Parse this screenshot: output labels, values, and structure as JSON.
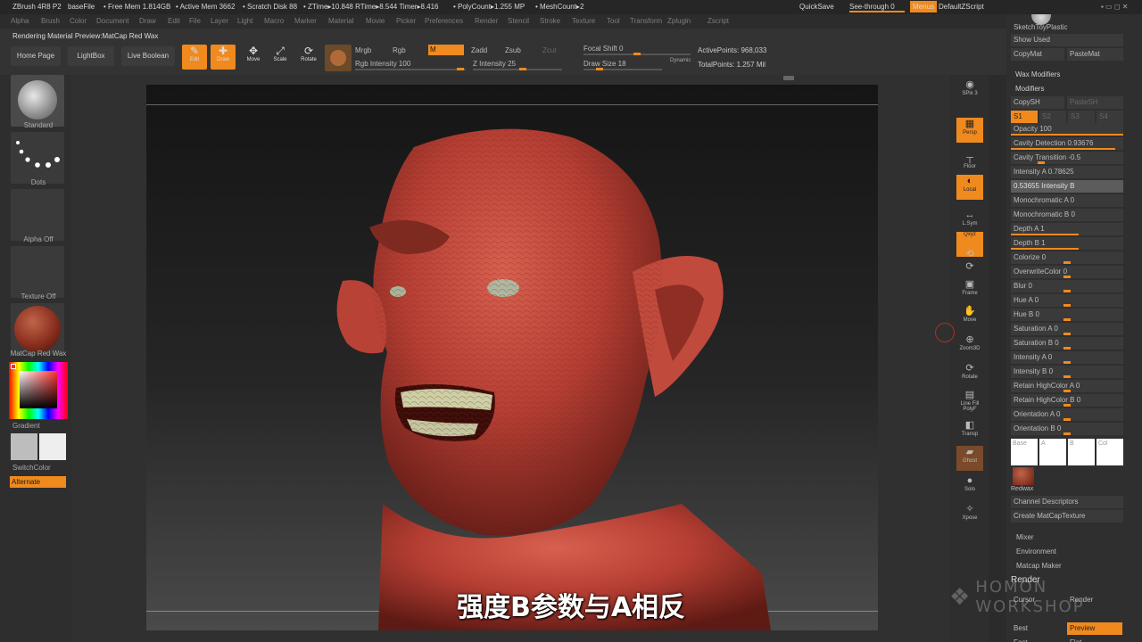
{
  "titlebar": {
    "app": "ZBrush 4R8 P2",
    "file": "baseFile",
    "free_mem": "• Free Mem 1.814GB",
    "active_mem": "• Active Mem 3662",
    "scratch": "• Scratch Disk 88",
    "timers": "• ZTime▸10.848 RTime▸8.544 Timer▸8.416",
    "polycount": "• PolyCount▸1.255 MP",
    "meshcount": "• MeshCount▸2",
    "quicksave": "QuickSave",
    "see_through": "See-through  0",
    "menus": "Menus",
    "default_zscript": "DefaultZScript"
  },
  "menubar": [
    "Alpha",
    "Brush",
    "Color",
    "Document",
    "Draw",
    "Edit",
    "File",
    "Layer",
    "Light",
    "Macro",
    "Marker",
    "Material",
    "Movie",
    "Picker",
    "Preferences",
    "Render",
    "Stencil",
    "Stroke",
    "Texture",
    "Tool",
    "Transform",
    "Zplugin",
    "Zscript"
  ],
  "status_message": "Rendering Material Preview:MatCap Red Wax",
  "toolbar": {
    "home_page": "Home Page",
    "lightbox": "LightBox",
    "live_boolean": "Live Boolean",
    "edit": "Edit",
    "draw": "Draw",
    "move": "Move",
    "scale": "Scale",
    "rotate": "Rotate",
    "mrgb": "Mrgb",
    "rgb": "Rgb",
    "m": "M",
    "zadd": "Zadd",
    "zsub": "Zsub",
    "zcut": "Zcut",
    "rgb_intensity": "Rgb Intensity 100",
    "z_intensity": "Z Intensity 25",
    "focal_shift": "Focal Shift 0",
    "draw_size": "Draw Size 18",
    "dynamic": "Dynamic",
    "active_points": "ActivePoints: 968,033",
    "total_points": "TotalPoints: 1.257 Mil"
  },
  "leftshelf": {
    "brush": "Standard",
    "stroke": "Dots",
    "alpha": "Alpha Off",
    "texture": "Texture Off",
    "material": "MatCap Red Wax",
    "gradient": "Gradient",
    "switch_color": "SwitchColor",
    "alternate": "Alternate"
  },
  "rightshelf": [
    "SPix 3",
    "Persp",
    "Floor",
    "Local",
    "L.Sym",
    "Qxyz",
    "",
    "",
    "Frame",
    "Move",
    "Zoom3D",
    "Rotate",
    "Line Fill PolyF",
    "Transp",
    "Ghost",
    "Solo",
    "Xpose"
  ],
  "palette": {
    "top_material": "SketchToyPlastic",
    "show_used": "Show Used",
    "copy_mat": "CopyMat",
    "paste_mat": "PasteMat",
    "wax_modifiers": "Wax Modifiers",
    "modifiers": "Modifiers",
    "copy_sh": "CopySH",
    "paste_sh": "PasteSH",
    "s_tabs": [
      "S1",
      "S2",
      "S3",
      "S4"
    ],
    "rows": [
      {
        "label": "Opacity 100",
        "fill": 1.0
      },
      {
        "label": "Cavity Detection 0.93676",
        "fill": 0.93
      },
      {
        "label": "Cavity Transition -0.5",
        "fill": 0.25
      },
      {
        "label": "Intensity A 0.78625",
        "fill": 0.0
      },
      {
        "label": "0.53655 Intensity B",
        "fill": 0.0
      },
      {
        "label": "Monochromatic A 0",
        "fill": 0.0
      },
      {
        "label": "Monochromatic B 0",
        "fill": 0.0
      },
      {
        "label": "Depth A 1",
        "fill": 0.6
      },
      {
        "label": "Depth B 1",
        "fill": 0.6
      },
      {
        "label": "Colorize 0",
        "fill": 0.5
      },
      {
        "label": "OverwriteColor 0",
        "fill": 0.5
      },
      {
        "label": "Blur 0",
        "fill": 0.5
      },
      {
        "label": "Hue A 0",
        "fill": 0.5
      },
      {
        "label": "Hue B 0",
        "fill": 0.5
      },
      {
        "label": "Saturation A 0",
        "fill": 0.5
      },
      {
        "label": "Saturation B 0",
        "fill": 0.5
      },
      {
        "label": "Intensity A 0",
        "fill": 0.5
      },
      {
        "label": "Intensity B 0",
        "fill": 0.5
      },
      {
        "label": "Retain HighColor A 0",
        "fill": 0.5
      },
      {
        "label": "Retain HighColor B 0",
        "fill": 0.5
      },
      {
        "label": "Orientation A 0",
        "fill": 0.5
      },
      {
        "label": "Orientation B 0",
        "fill": 0.5
      }
    ],
    "swatches": [
      "Base",
      "A",
      "B",
      "Col"
    ],
    "redwax": "Redwax",
    "channel_descriptors": "Channel Descriptors",
    "create_matcap": "Create MatCapTexture",
    "mixer": "Mixer",
    "environment": "Environment",
    "matcap_maker": "Matcap Maker",
    "render": "Render",
    "cursor": "Cursor",
    "render_btn": "Render",
    "best": "Best",
    "preview": "Preview",
    "fast": "Fast",
    "flat": "Flat"
  },
  "subtitle": "强度B参数与A相反",
  "watermark": "HOMON WORKSHOP",
  "colors": {
    "accent": "#f08a1e",
    "skin": "#c5473c"
  }
}
